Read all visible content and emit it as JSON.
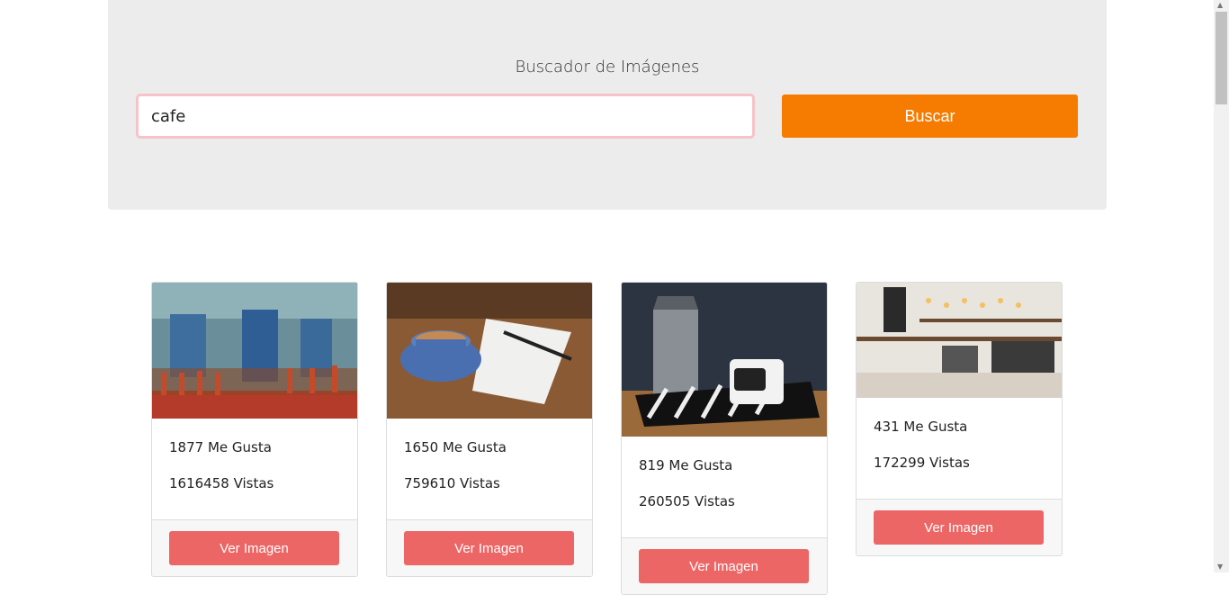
{
  "header": {
    "title": "Buscador de Imágenes",
    "search_value": "cafe",
    "search_button_label": "Buscar"
  },
  "results": [
    {
      "likes": "1877 Me Gusta",
      "views": "1616458 Vistas",
      "button_label": "Ver Imagen",
      "image": "street-cafe-photo"
    },
    {
      "likes": "1650 Me Gusta",
      "views": "759610 Vistas",
      "button_label": "Ver Imagen",
      "image": "coffee-cup-notebook-photo"
    },
    {
      "likes": "819 Me Gusta",
      "views": "260505 Vistas",
      "button_label": "Ver Imagen",
      "image": "coffee-pot-cup-photo"
    },
    {
      "likes": "431 Me Gusta",
      "views": "172299 Vistas",
      "button_label": "Ver Imagen",
      "image": "coffee-shop-counter-photo"
    }
  ],
  "colors": {
    "jumbotron_bg": "#ececec",
    "search_button": "#f57c00",
    "card_button": "#ec6665",
    "input_border": "#f6c4c8"
  }
}
